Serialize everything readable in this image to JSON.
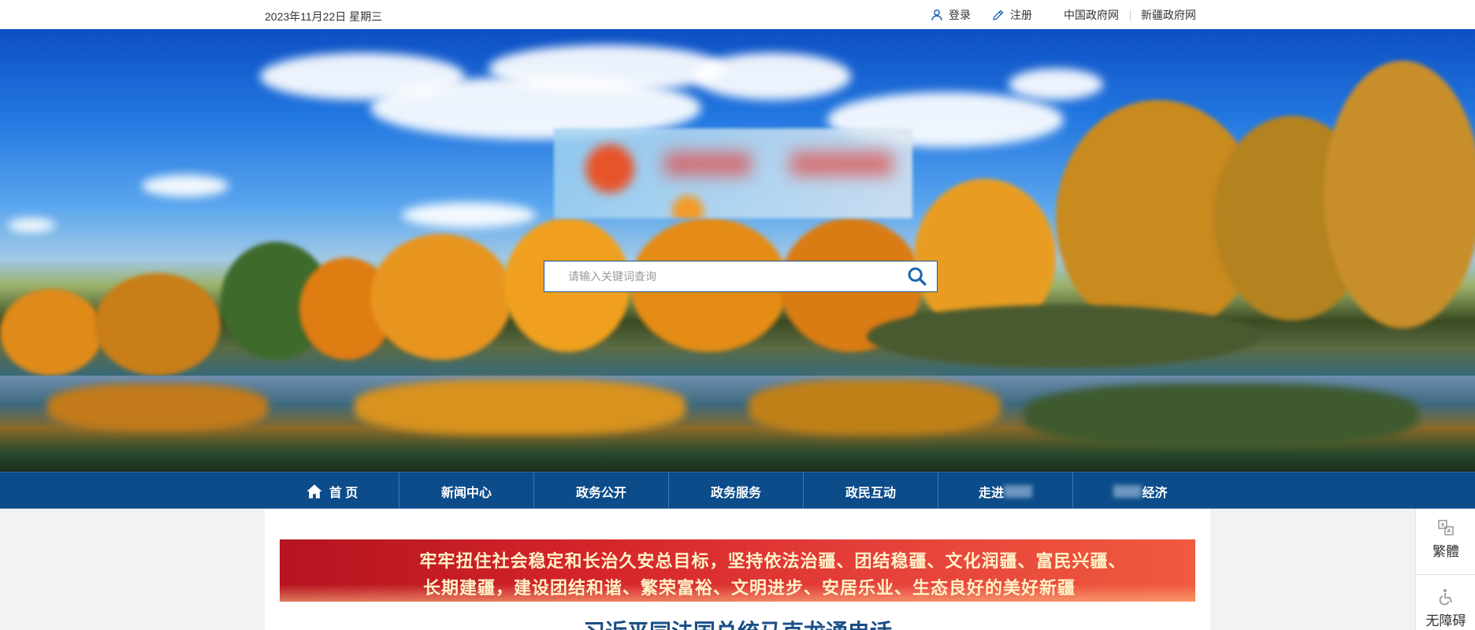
{
  "topbar": {
    "date": "2023年11月22日 星期三",
    "login_label": "登录",
    "register_label": "注册",
    "link_china_gov": "中国政府网",
    "link_xinjiang_gov": "新疆政府网"
  },
  "search": {
    "placeholder": "请输入关键词查询"
  },
  "nav": {
    "items": [
      {
        "label": "首 页",
        "icon": "home-icon"
      },
      {
        "label": "新闻中心"
      },
      {
        "label": "政务公开"
      },
      {
        "label": "政务服务"
      },
      {
        "label": "政民互动"
      },
      {
        "label": "走进"
      },
      {
        "label": "经济"
      }
    ]
  },
  "slogan": {
    "line1": "牢牢扭住社会稳定和长治久安总目标，坚持依法治疆、团结稳疆、文化润疆、富民兴疆、",
    "line2": "长期建疆，建设团结和谐、繁荣富裕、文明进步、安居乐业、生态良好的美好新疆"
  },
  "headline": "习近平同法国总统马克龙通电话",
  "sidebar": {
    "traditional_label": "繁體",
    "accessibility_label": "无障碍"
  },
  "colors": {
    "nav_bg": "#0c4c8a",
    "slogan_bg": "#d5252a",
    "headline": "#1b4f86",
    "search_icon": "#1a64b0"
  }
}
